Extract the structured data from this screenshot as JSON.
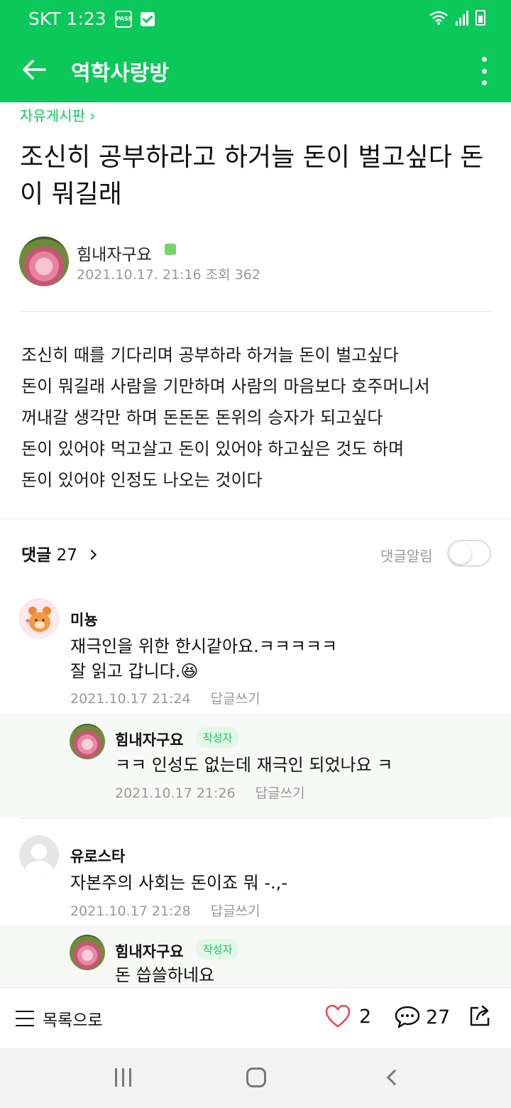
{
  "status_bar": {
    "carrier_time": "SKT 1:23",
    "pass_badge": "PASS"
  },
  "app_bar": {
    "title": "역학사랑방"
  },
  "post": {
    "board": "자유게시판 ›",
    "title": "조신히 공부하라고 하거늘 돈이 벌고싶다 돈이 뭐길래",
    "author": "힘내자구요",
    "date_views": "2021.10.17. 21:16  조회 362",
    "body_lines": [
      "조신히 때를 기다리며 공부하라 하거늘 돈이 벌고싶다",
      "돈이 뭐길래 사람을 기만하며 사람의 마음보다 호주머니서",
      "꺼내갈 생각만 하며 돈돈돈 돈위의 승자가 되고싶다",
      "돈이 있어야 먹고살고 돈이 있어야 하고싶은 것도 하며",
      "돈이 있어야 인정도 나오는 것이다"
    ]
  },
  "comments_header": {
    "label": "댓글",
    "count": "27",
    "alarm_label": "댓글알림"
  },
  "comments": [
    {
      "name": "미뇽",
      "text_line1": "재극인을 위한 한시같아요.ㅋㅋㅋㅋㅋ",
      "text_line2": "잘 읽고 갑니다.😆",
      "date": "2021.10.17 21:24",
      "reply_label": "답글쓰기",
      "reply": {
        "name": "힘내자구요",
        "tag": "작성자",
        "text": "ㅋㅋ 인성도 없는데 재극인 되었나요 ㅋ",
        "date": "2021.10.17 21:26",
        "reply_label": "답글쓰기"
      }
    },
    {
      "name": "유로스타",
      "text_line1": "자본주의 사회는 돈이죠 뭐 -.,-",
      "date": "2021.10.17 21:28",
      "reply_label": "답글쓰기",
      "reply": {
        "name": "힘내자구요",
        "tag": "작성자",
        "text": "돈 씁쓸하네요"
      }
    }
  ],
  "bottom_bar": {
    "list_label": "목록으로",
    "likes": "2",
    "comments": "27"
  },
  "colors": {
    "brand_green": "#0ac85a",
    "like_red": "#e8434b"
  }
}
